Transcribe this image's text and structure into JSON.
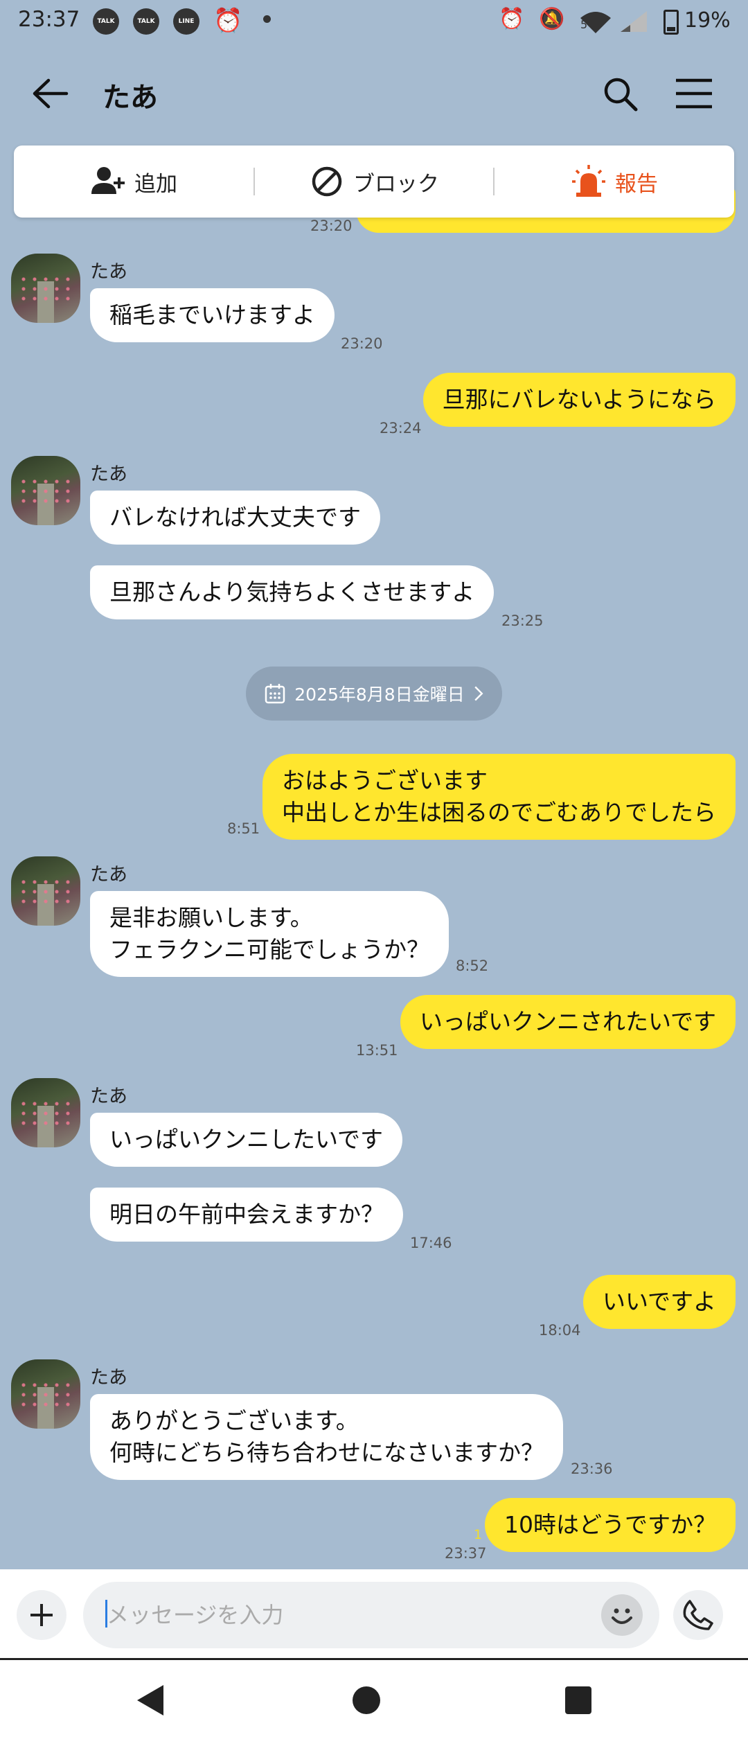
{
  "status_bar": {
    "time": "23:37",
    "notif_icons": [
      "TALK",
      "TALK",
      "LINE"
    ],
    "network": "5",
    "battery": "19%"
  },
  "header": {
    "title": "たあ"
  },
  "actions": {
    "add": "追加",
    "block": "ブロック",
    "report": "報告"
  },
  "colors": {
    "background": "#a6bbd0",
    "outgoing": "#ffe62e",
    "incoming": "#ffffff",
    "report": "#e8521c"
  },
  "messages": {
    "m0": {
      "time": "23:20"
    },
    "g1": {
      "sender": "たあ"
    },
    "m1": {
      "text": "稲毛までいけますよ",
      "time": "23:20"
    },
    "m2": {
      "text": "旦那にバレないようになら",
      "time": "23:24"
    },
    "g2": {
      "sender": "たあ"
    },
    "m3": {
      "text": "バレなければ大丈夫です"
    },
    "m4": {
      "text": "旦那さんより気持ちよくさせますよ",
      "time": "23:25"
    },
    "date": "2025年8月8日金曜日",
    "m5": {
      "text": "おはようございます\n中出しとか生は困るのでごむありでしたら",
      "time": "8:51"
    },
    "g3": {
      "sender": "たあ"
    },
    "m6": {
      "text": "是非お願いします。\nフェラクンニ可能でしょうか？",
      "time": "8:52"
    },
    "m7": {
      "text": "いっぱいクンニされたいです",
      "time": "13:51"
    },
    "g4": {
      "sender": "たあ"
    },
    "m8": {
      "text": "いっぱいクンニしたいです"
    },
    "m9": {
      "text": "明日の午前中会えますか？",
      "time": "17:46"
    },
    "m10": {
      "text": "いいですよ",
      "time": "18:04"
    },
    "g5": {
      "sender": "たあ"
    },
    "m11": {
      "text": "ありがとうございます。\n何時にどちら待ち合わせになさいますか？",
      "time": "23:36"
    },
    "m12": {
      "text": "10時はどうですか？",
      "time": "23:37",
      "read": "1"
    }
  },
  "input": {
    "placeholder": "メッセージを入力"
  }
}
